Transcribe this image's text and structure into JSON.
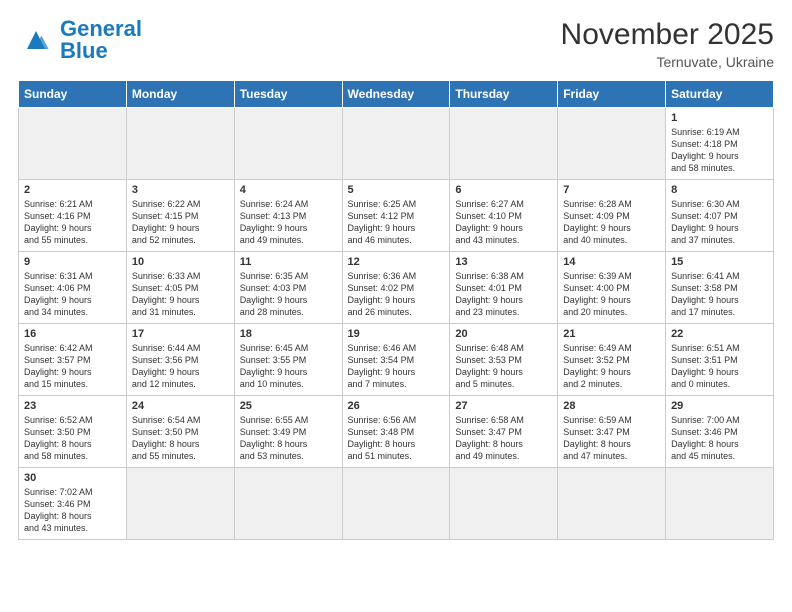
{
  "logo": {
    "text_general": "General",
    "text_blue": "Blue"
  },
  "header": {
    "month": "November 2025",
    "location": "Ternuvate, Ukraine"
  },
  "days_of_week": [
    "Sunday",
    "Monday",
    "Tuesday",
    "Wednesday",
    "Thursday",
    "Friday",
    "Saturday"
  ],
  "weeks": [
    [
      {
        "day": "",
        "info": "",
        "empty": true
      },
      {
        "day": "",
        "info": "",
        "empty": true
      },
      {
        "day": "",
        "info": "",
        "empty": true
      },
      {
        "day": "",
        "info": "",
        "empty": true
      },
      {
        "day": "",
        "info": "",
        "empty": true
      },
      {
        "day": "",
        "info": "",
        "empty": true
      },
      {
        "day": "1",
        "info": "Sunrise: 6:19 AM\nSunset: 4:18 PM\nDaylight: 9 hours\nand 58 minutes."
      }
    ],
    [
      {
        "day": "2",
        "info": "Sunrise: 6:21 AM\nSunset: 4:16 PM\nDaylight: 9 hours\nand 55 minutes."
      },
      {
        "day": "3",
        "info": "Sunrise: 6:22 AM\nSunset: 4:15 PM\nDaylight: 9 hours\nand 52 minutes."
      },
      {
        "day": "4",
        "info": "Sunrise: 6:24 AM\nSunset: 4:13 PM\nDaylight: 9 hours\nand 49 minutes."
      },
      {
        "day": "5",
        "info": "Sunrise: 6:25 AM\nSunset: 4:12 PM\nDaylight: 9 hours\nand 46 minutes."
      },
      {
        "day": "6",
        "info": "Sunrise: 6:27 AM\nSunset: 4:10 PM\nDaylight: 9 hours\nand 43 minutes."
      },
      {
        "day": "7",
        "info": "Sunrise: 6:28 AM\nSunset: 4:09 PM\nDaylight: 9 hours\nand 40 minutes."
      },
      {
        "day": "8",
        "info": "Sunrise: 6:30 AM\nSunset: 4:07 PM\nDaylight: 9 hours\nand 37 minutes."
      }
    ],
    [
      {
        "day": "9",
        "info": "Sunrise: 6:31 AM\nSunset: 4:06 PM\nDaylight: 9 hours\nand 34 minutes."
      },
      {
        "day": "10",
        "info": "Sunrise: 6:33 AM\nSunset: 4:05 PM\nDaylight: 9 hours\nand 31 minutes."
      },
      {
        "day": "11",
        "info": "Sunrise: 6:35 AM\nSunset: 4:03 PM\nDaylight: 9 hours\nand 28 minutes."
      },
      {
        "day": "12",
        "info": "Sunrise: 6:36 AM\nSunset: 4:02 PM\nDaylight: 9 hours\nand 26 minutes."
      },
      {
        "day": "13",
        "info": "Sunrise: 6:38 AM\nSunset: 4:01 PM\nDaylight: 9 hours\nand 23 minutes."
      },
      {
        "day": "14",
        "info": "Sunrise: 6:39 AM\nSunset: 4:00 PM\nDaylight: 9 hours\nand 20 minutes."
      },
      {
        "day": "15",
        "info": "Sunrise: 6:41 AM\nSunset: 3:58 PM\nDaylight: 9 hours\nand 17 minutes."
      }
    ],
    [
      {
        "day": "16",
        "info": "Sunrise: 6:42 AM\nSunset: 3:57 PM\nDaylight: 9 hours\nand 15 minutes."
      },
      {
        "day": "17",
        "info": "Sunrise: 6:44 AM\nSunset: 3:56 PM\nDaylight: 9 hours\nand 12 minutes."
      },
      {
        "day": "18",
        "info": "Sunrise: 6:45 AM\nSunset: 3:55 PM\nDaylight: 9 hours\nand 10 minutes."
      },
      {
        "day": "19",
        "info": "Sunrise: 6:46 AM\nSunset: 3:54 PM\nDaylight: 9 hours\nand 7 minutes."
      },
      {
        "day": "20",
        "info": "Sunrise: 6:48 AM\nSunset: 3:53 PM\nDaylight: 9 hours\nand 5 minutes."
      },
      {
        "day": "21",
        "info": "Sunrise: 6:49 AM\nSunset: 3:52 PM\nDaylight: 9 hours\nand 2 minutes."
      },
      {
        "day": "22",
        "info": "Sunrise: 6:51 AM\nSunset: 3:51 PM\nDaylight: 9 hours\nand 0 minutes."
      }
    ],
    [
      {
        "day": "23",
        "info": "Sunrise: 6:52 AM\nSunset: 3:50 PM\nDaylight: 8 hours\nand 58 minutes."
      },
      {
        "day": "24",
        "info": "Sunrise: 6:54 AM\nSunset: 3:50 PM\nDaylight: 8 hours\nand 55 minutes."
      },
      {
        "day": "25",
        "info": "Sunrise: 6:55 AM\nSunset: 3:49 PM\nDaylight: 8 hours\nand 53 minutes."
      },
      {
        "day": "26",
        "info": "Sunrise: 6:56 AM\nSunset: 3:48 PM\nDaylight: 8 hours\nand 51 minutes."
      },
      {
        "day": "27",
        "info": "Sunrise: 6:58 AM\nSunset: 3:47 PM\nDaylight: 8 hours\nand 49 minutes."
      },
      {
        "day": "28",
        "info": "Sunrise: 6:59 AM\nSunset: 3:47 PM\nDaylight: 8 hours\nand 47 minutes."
      },
      {
        "day": "29",
        "info": "Sunrise: 7:00 AM\nSunset: 3:46 PM\nDaylight: 8 hours\nand 45 minutes."
      }
    ],
    [
      {
        "day": "30",
        "info": "Sunrise: 7:02 AM\nSunset: 3:46 PM\nDaylight: 8 hours\nand 43 minutes."
      },
      {
        "day": "",
        "info": "",
        "empty": true
      },
      {
        "day": "",
        "info": "",
        "empty": true
      },
      {
        "day": "",
        "info": "",
        "empty": true
      },
      {
        "day": "",
        "info": "",
        "empty": true
      },
      {
        "day": "",
        "info": "",
        "empty": true
      },
      {
        "day": "",
        "info": "",
        "empty": true
      }
    ]
  ]
}
